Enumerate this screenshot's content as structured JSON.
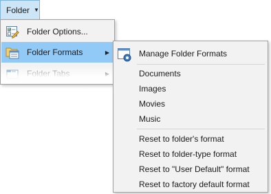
{
  "toolbar": {
    "folder_label": "Folder"
  },
  "menu": {
    "items": [
      {
        "label": "Folder Options...",
        "icon": "folder-options-icon"
      },
      {
        "label": "Folder Formats",
        "icon": "folder-formats-icon",
        "highlighted": true,
        "has_submenu": true
      },
      {
        "label": "Folder Tabs",
        "icon": "folder-tabs-icon",
        "has_submenu": true
      }
    ]
  },
  "submenu": {
    "manage_label": "Manage Folder Formats",
    "manage_icon": "manage-folder-formats-icon",
    "formats": [
      "Documents",
      "Images",
      "Movies",
      "Music"
    ],
    "resets": [
      "Reset to folder's format",
      "Reset to folder-type format",
      "Reset to \"User Default\" format",
      "Reset to factory default format"
    ]
  },
  "colors": {
    "highlight": "#91c9f7",
    "menu_background": "#f2f2f2",
    "button_background": "#cde6f7"
  }
}
